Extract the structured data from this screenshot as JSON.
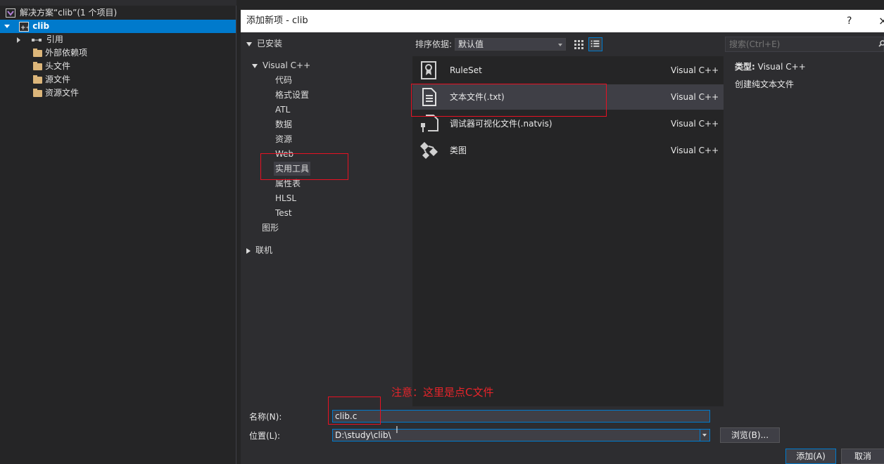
{
  "solution_explorer": {
    "solution_label": "解决方案“clib”(1 个项目)",
    "project_label": "clib",
    "items": [
      {
        "label": "引用",
        "icon": "references-icon"
      },
      {
        "label": "外部依赖项",
        "icon": "external-deps-icon"
      },
      {
        "label": "头文件",
        "icon": "folder-icon"
      },
      {
        "label": "源文件",
        "icon": "folder-icon"
      },
      {
        "label": "资源文件",
        "icon": "folder-icon"
      }
    ]
  },
  "dialog": {
    "title": "添加新项 - clib",
    "help": "?",
    "close": "×",
    "categories": {
      "installed": "已安装",
      "visual_cpp": "Visual C++",
      "children": [
        "代码",
        "格式设置",
        "ATL",
        "数据",
        "资源",
        "Web",
        "实用工具",
        "属性表",
        "HLSL",
        "Test"
      ],
      "graphics": "图形",
      "online": "联机"
    },
    "sort_label": "排序依据:",
    "sort_value": "默认值",
    "search_placeholder": "搜索(Ctrl+E)",
    "templates": [
      {
        "name": "RuleSet",
        "lang": "Visual C++",
        "icon": "ruleset-icon"
      },
      {
        "name": "文本文件(.txt)",
        "lang": "Visual C++",
        "icon": "text-file-icon"
      },
      {
        "name": "调试器可视化文件(.natvis)",
        "lang": "Visual C++",
        "icon": "natvis-file-icon"
      },
      {
        "name": "类图",
        "lang": "Visual C++",
        "icon": "class-diagram-icon"
      }
    ],
    "info": {
      "type_label": "类型:",
      "type_value": "Visual C++",
      "description": "创建纯文本文件"
    },
    "name_label": "名称(N):",
    "name_value": "clib.c",
    "location_label": "位置(L):",
    "location_value": "D:\\study\\clib\\",
    "browse_label": "浏览(B)...",
    "add_label": "添加(A)",
    "cancel_label": "取消"
  },
  "annotation": {
    "note": "注意：这里是点C文件",
    "color": "#e81123"
  }
}
